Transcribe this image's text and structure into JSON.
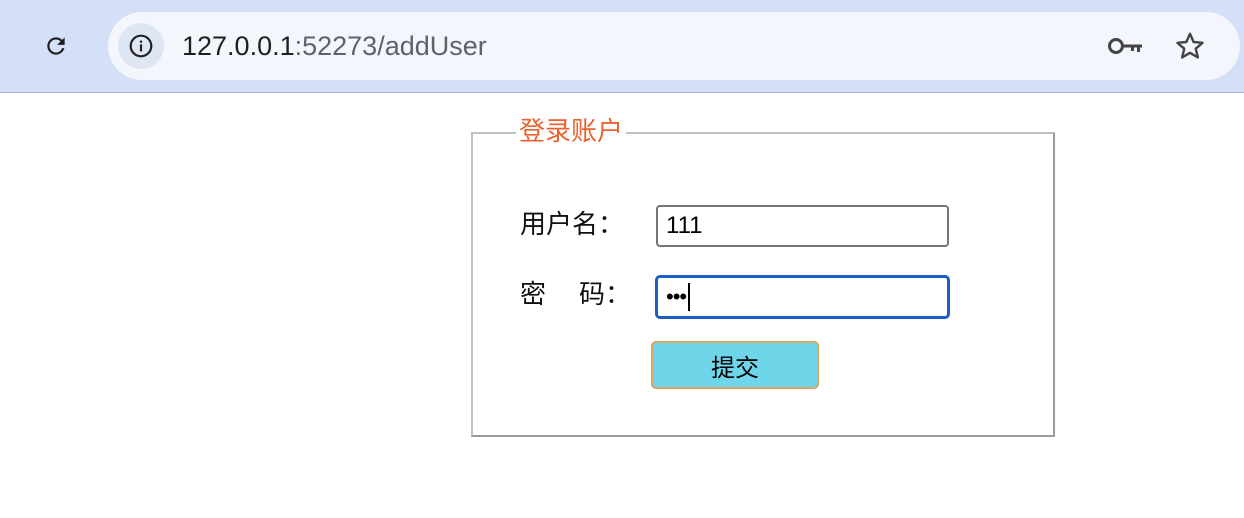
{
  "browser": {
    "url_host": "127.0.0.1",
    "url_rest": ":52273/addUser",
    "icons": {
      "reload": "reload-icon",
      "site_info": "info-icon",
      "key": "key-icon",
      "bookmark": "star-icon"
    }
  },
  "form": {
    "legend": "登录账户",
    "username_label": "用户名：",
    "username_value": "111",
    "password_label": "密    码：",
    "password_value": "•••",
    "submit_label": "提交"
  },
  "colors": {
    "legend": "#e8632f",
    "submit_bg": "#6fd5e8",
    "submit_border": "#d7a56a",
    "focus_border": "#1b5fc4",
    "toolbar_bg": "#d3e0f7"
  }
}
